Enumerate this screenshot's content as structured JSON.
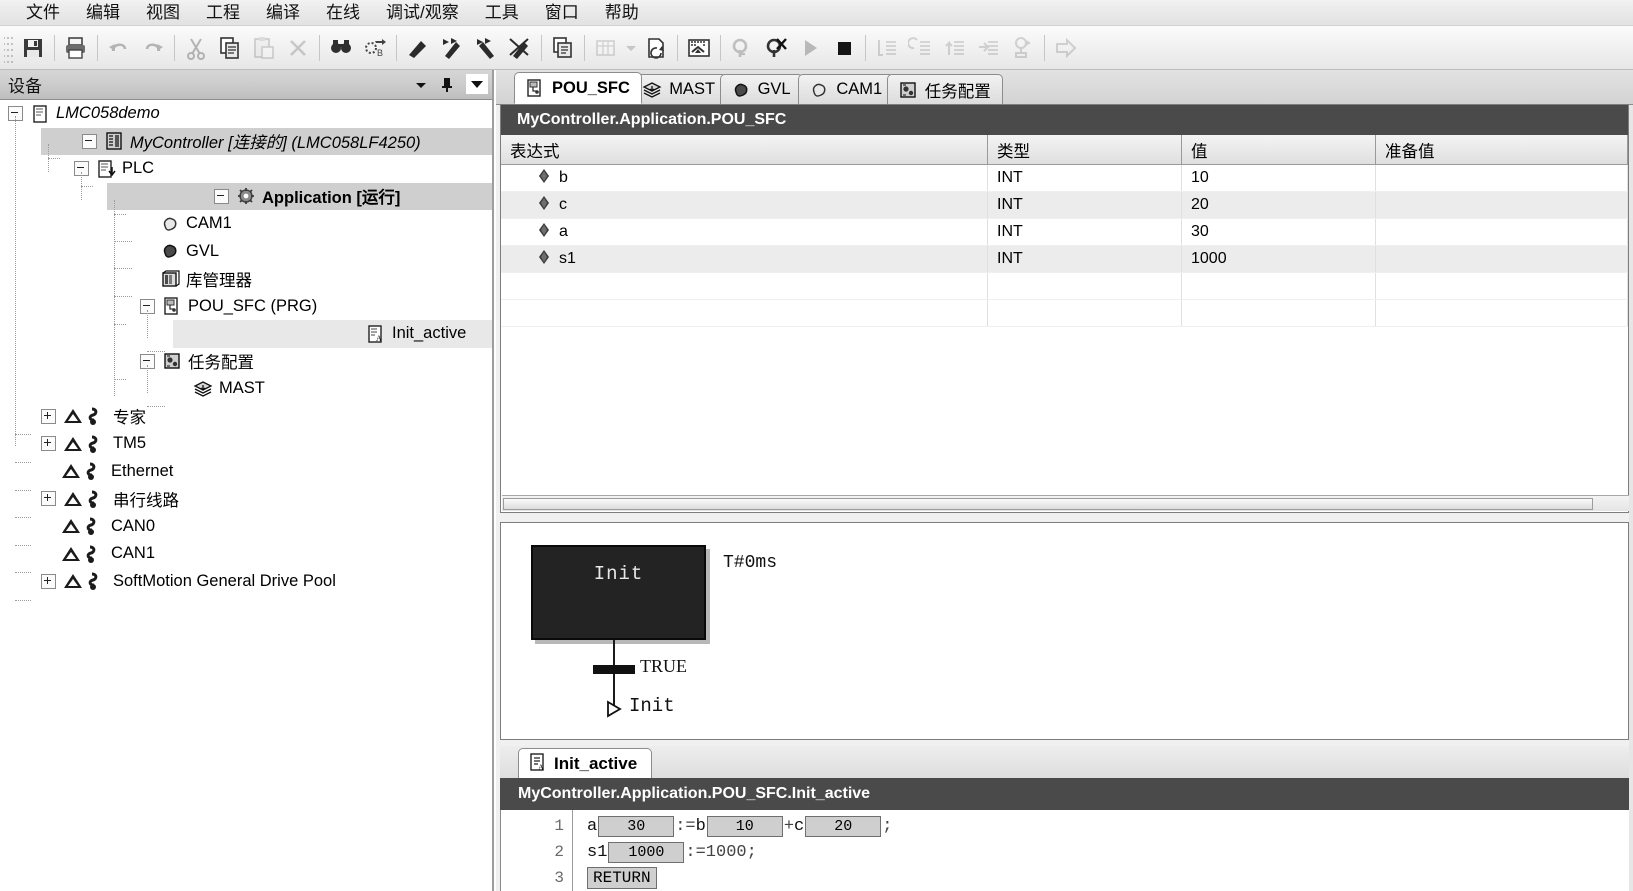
{
  "menu": {
    "items": [
      {
        "label": "文件",
        "name": "menu-file"
      },
      {
        "label": "编辑",
        "name": "menu-edit"
      },
      {
        "label": "视图",
        "name": "menu-view"
      },
      {
        "label": "工程",
        "name": "menu-project"
      },
      {
        "label": "编译",
        "name": "menu-build"
      },
      {
        "label": "在线",
        "name": "menu-online"
      },
      {
        "label": "调试/观察",
        "name": "menu-debug-watch"
      },
      {
        "label": "工具",
        "name": "menu-tools"
      },
      {
        "label": "窗口",
        "name": "menu-window"
      },
      {
        "label": "帮助",
        "name": "menu-help"
      }
    ]
  },
  "toolbar": {
    "buttons": [
      {
        "icon": "save-icon",
        "enabled": true
      },
      {
        "icon": "print-icon",
        "enabled": true
      },
      {
        "icon": "undo-icon",
        "enabled": false
      },
      {
        "icon": "redo-icon",
        "enabled": false
      },
      {
        "icon": "cut-icon",
        "enabled": false
      },
      {
        "icon": "copy-icon",
        "enabled": true
      },
      {
        "icon": "paste-icon",
        "enabled": false
      },
      {
        "icon": "delete-icon",
        "enabled": false
      },
      {
        "icon": "find-icon",
        "enabled": true
      },
      {
        "icon": "replace-icon",
        "enabled": true
      },
      {
        "icon": "breakpoint-icon",
        "enabled": true
      },
      {
        "icon": "step-over-icon",
        "enabled": true
      },
      {
        "icon": "step-into-icon",
        "enabled": true
      },
      {
        "icon": "step-out-icon",
        "enabled": true
      },
      {
        "icon": "clipboard-list-icon",
        "enabled": true
      },
      {
        "icon": "grid-dropdown-icon",
        "enabled": false
      },
      {
        "icon": "new-page-icon",
        "enabled": true
      },
      {
        "icon": "build-icon",
        "enabled": true
      },
      {
        "icon": "login-icon",
        "enabled": false
      },
      {
        "icon": "logout-icon",
        "enabled": true
      },
      {
        "icon": "run-icon",
        "enabled": false
      },
      {
        "icon": "stop-icon",
        "enabled": true
      },
      {
        "icon": "step-line-icon",
        "enabled": false
      },
      {
        "icon": "step-back-icon",
        "enabled": false
      },
      {
        "icon": "step-up-icon",
        "enabled": false
      },
      {
        "icon": "step-to-icon",
        "enabled": false
      },
      {
        "icon": "cycle-icon",
        "enabled": false
      },
      {
        "icon": "arrow-right-icon",
        "enabled": false
      }
    ]
  },
  "devices": {
    "title": "设备",
    "header_buttons": [
      {
        "name": "panel-dropdown-icon",
        "glyph": "▼"
      },
      {
        "name": "pin-icon",
        "glyph": "pin"
      },
      {
        "name": "close-icon",
        "glyph": "✕"
      }
    ],
    "tree": [
      {
        "label": "LMC058demo",
        "icon": "project-icon",
        "depth": 0,
        "expander": "minus",
        "style": "italic",
        "selected": false
      },
      {
        "label": "MyController [连接的] (LMC058LF4250)",
        "icon": "controller-icon",
        "depth": 1,
        "expander": "minus",
        "style": "italic",
        "selected": true
      },
      {
        "label": "PLC",
        "icon": "plc-icon",
        "depth": 2,
        "expander": "minus",
        "style": "normal",
        "selected": false
      },
      {
        "label": "Application [运行]",
        "icon": "application-icon",
        "depth": 3,
        "expander": "minus",
        "style": "bold",
        "selected": true
      },
      {
        "label": "CAM1",
        "icon": "cam-icon",
        "depth": 4,
        "expander": "none",
        "style": "normal",
        "selected": false
      },
      {
        "label": "GVL",
        "icon": "gvl-icon",
        "depth": 4,
        "expander": "none",
        "style": "normal",
        "selected": false
      },
      {
        "label": "库管理器",
        "icon": "library-manager-icon",
        "depth": 4,
        "expander": "none",
        "style": "normal",
        "selected": false
      },
      {
        "label": "POU_SFC (PRG)",
        "icon": "pou-icon",
        "depth": 4,
        "expander": "minus",
        "style": "normal",
        "selected": false
      },
      {
        "label": "Init_active",
        "icon": "action-icon",
        "depth": 5,
        "expander": "none",
        "style": "normal",
        "selected": false,
        "highlight": true
      },
      {
        "label": "任务配置",
        "icon": "task-config-icon",
        "depth": 4,
        "expander": "minus",
        "style": "normal",
        "selected": false
      },
      {
        "label": "MAST",
        "icon": "task-icon",
        "depth": 5,
        "expander": "none",
        "style": "normal",
        "selected": false
      },
      {
        "label": "专家",
        "icon": "device-icon",
        "depth": 1,
        "expander": "plus",
        "style": "normal",
        "selected": false
      },
      {
        "label": "TM5",
        "icon": "device-icon",
        "depth": 1,
        "expander": "plus",
        "style": "normal",
        "selected": false
      },
      {
        "label": "Ethernet",
        "icon": "device-icon",
        "depth": 1,
        "expander": "none",
        "style": "normal",
        "selected": false
      },
      {
        "label": "串行线路",
        "icon": "device-icon",
        "depth": 1,
        "expander": "plus",
        "style": "normal",
        "selected": false
      },
      {
        "label": "CAN0",
        "icon": "device-icon",
        "depth": 1,
        "expander": "none",
        "style": "normal",
        "selected": false
      },
      {
        "label": "CAN1",
        "icon": "device-icon",
        "depth": 1,
        "expander": "none",
        "style": "normal",
        "selected": false
      },
      {
        "label": "SoftMotion General Drive Pool",
        "icon": "device-icon",
        "depth": 1,
        "expander": "plus",
        "style": "normal",
        "selected": false
      }
    ]
  },
  "editor": {
    "tabs": [
      {
        "label": "POU_SFC",
        "icon": "pou-icon",
        "active": true
      },
      {
        "label": "MAST",
        "icon": "task-icon",
        "active": false
      },
      {
        "label": "GVL",
        "icon": "gvl-icon",
        "active": false
      },
      {
        "label": "CAM1",
        "icon": "cam-icon",
        "active": false
      },
      {
        "label": "任务配置",
        "icon": "task-config-icon",
        "active": false
      }
    ],
    "path": "MyController.Application.POU_SFC",
    "table": {
      "columns": [
        "表达式",
        "类型",
        "值",
        "准备值"
      ],
      "rows": [
        {
          "expression": "b",
          "type": "INT",
          "value": "10",
          "prepared": ""
        },
        {
          "expression": "c",
          "type": "INT",
          "value": "20",
          "prepared": ""
        },
        {
          "expression": "a",
          "type": "INT",
          "value": "30",
          "prepared": ""
        },
        {
          "expression": "s1",
          "type": "INT",
          "value": "1000",
          "prepared": ""
        }
      ]
    }
  },
  "sfc": {
    "step_name": "Init",
    "step_time": "T#0ms",
    "transition": "TRUE",
    "jump_target": "Init"
  },
  "code": {
    "tab_label": "Init_active",
    "tab_icon": "action-icon",
    "path": "MyController.Application.POU_SFC.Init_active",
    "lines": [
      {
        "num": "1",
        "parts": [
          {
            "t": "id",
            "v": "a"
          },
          {
            "t": "box",
            "v": "30"
          },
          {
            "t": "op",
            "v": ":="
          },
          {
            "t": "id",
            "v": "b"
          },
          {
            "t": "box",
            "v": "10"
          },
          {
            "t": "op",
            "v": "+"
          },
          {
            "t": "id",
            "v": "c"
          },
          {
            "t": "box",
            "v": "20"
          },
          {
            "t": "op",
            "v": ";"
          }
        ]
      },
      {
        "num": "2",
        "parts": [
          {
            "t": "id",
            "v": "s1"
          },
          {
            "t": "box",
            "v": "1000"
          },
          {
            "t": "op",
            "v": ":=1000;"
          }
        ]
      },
      {
        "num": "3",
        "parts": [
          {
            "t": "ret",
            "v": "RETURN"
          }
        ]
      }
    ]
  }
}
